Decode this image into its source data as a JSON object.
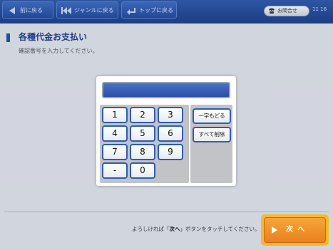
{
  "nav": {
    "back_label": "前に戻る",
    "genre_label": "ジャンルに戻る",
    "top_label": "トップに戻る",
    "inquiry_label": "お問合せ",
    "clock": "11 16"
  },
  "page": {
    "title": "各種代金お支払い",
    "subtitle": "確認番号を入力してください。",
    "instruction_prefix": "よろしければ「",
    "instruction_bold": "次へ",
    "instruction_suffix": "」ボタンをタッチしてください。",
    "next_label": "次へ"
  },
  "keypad": {
    "display_value": "",
    "keys": [
      "1",
      "2",
      "3",
      "4",
      "5",
      "6",
      "7",
      "8",
      "9",
      "-",
      "0"
    ],
    "backspace_label": "一字もどる",
    "clear_label": "すべて削除"
  },
  "colors": {
    "brand_blue": "#1d3f86",
    "key_border": "#2e5db3",
    "next_orange": "#e8811e"
  },
  "icons": {
    "back": "left-arrow-icon",
    "genre": "double-left-arrow-icon",
    "top": "return-arrow-icon",
    "inquiry": "phone-icon",
    "next": "play-icon"
  }
}
